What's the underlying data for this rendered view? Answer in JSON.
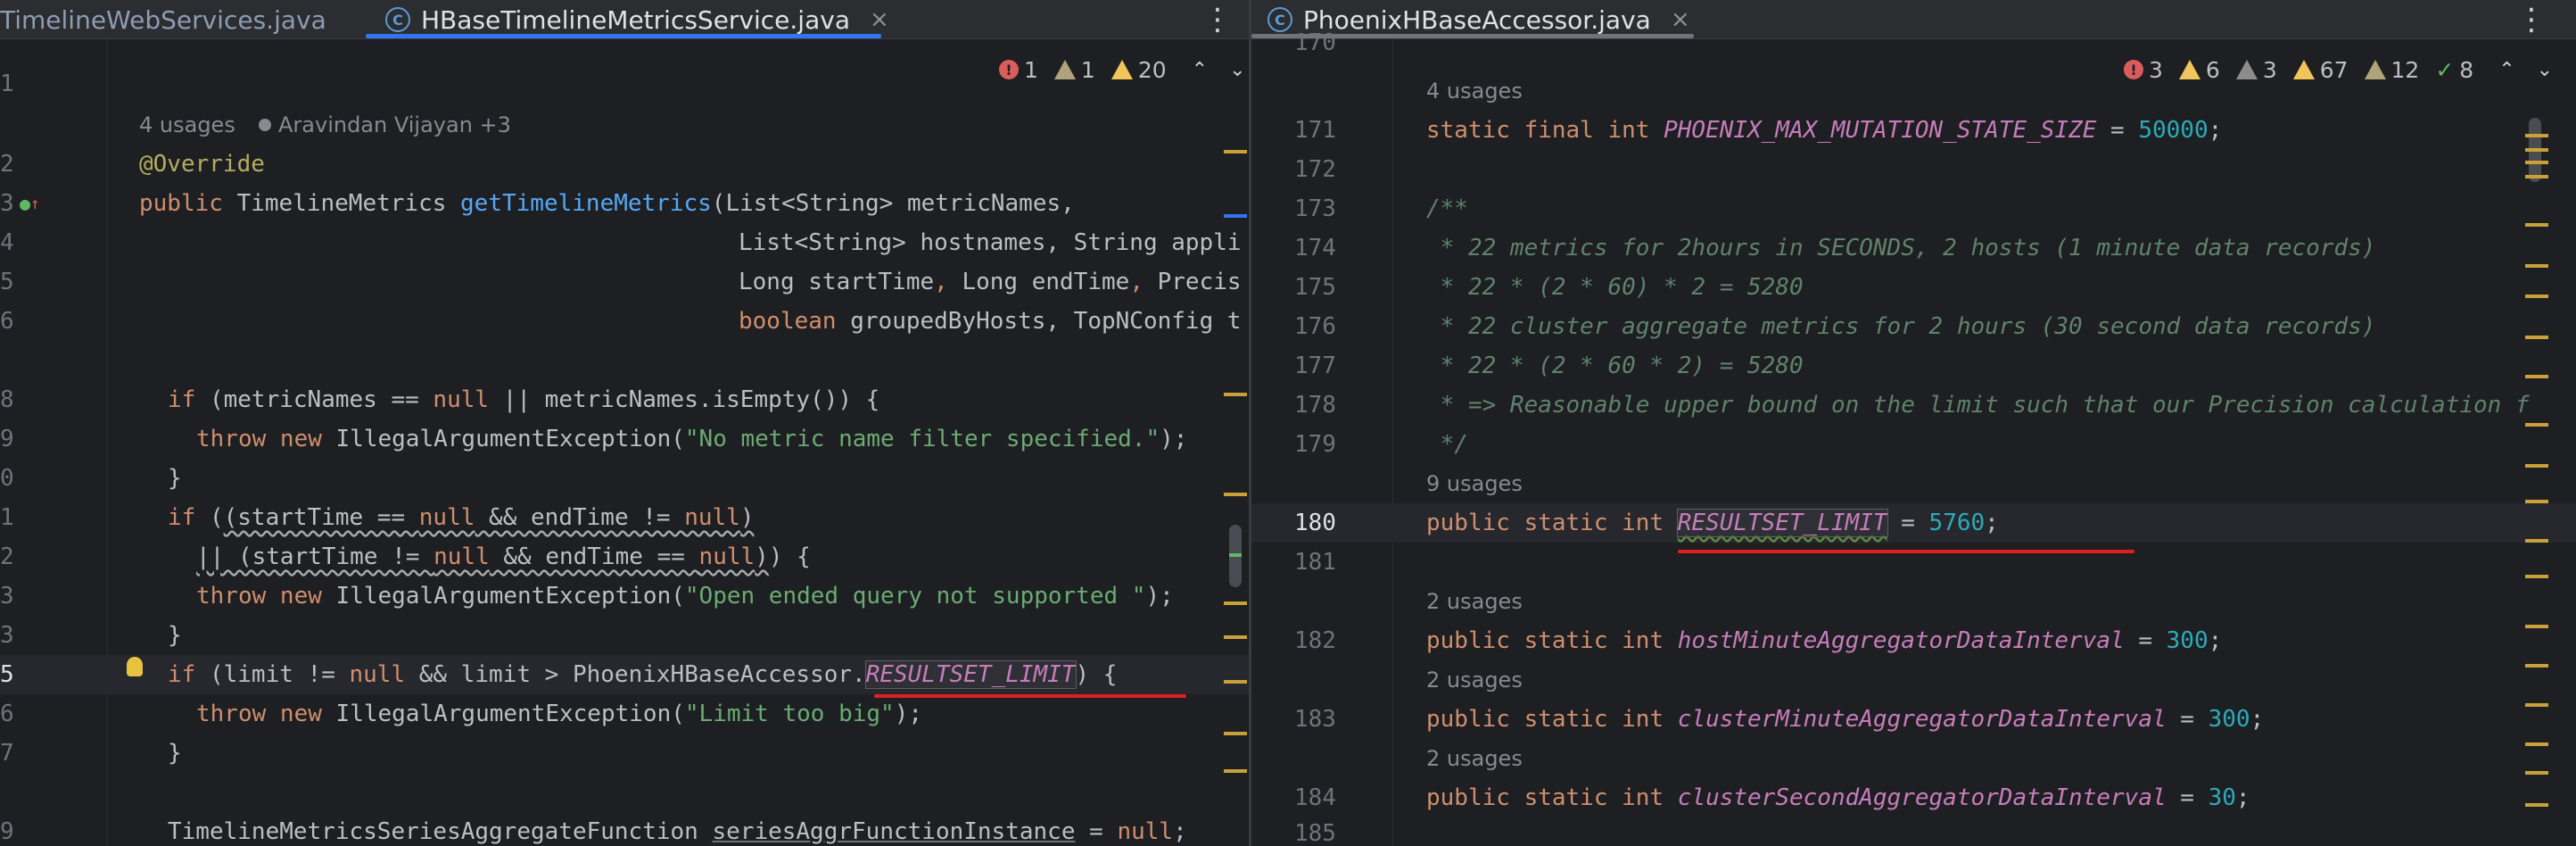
{
  "left": {
    "tabs": [
      {
        "label": "TimelineWebServices.java",
        "active": false
      },
      {
        "label": "HBaseTimelineMetricsService.java",
        "active": true
      }
    ],
    "inspections": {
      "errors": "1",
      "weak_warnings": "1",
      "warnings": "20"
    },
    "hints": {
      "usages": "4 usages",
      "author": "Aravindan Vijayan +3"
    },
    "line_numbers": [
      "",
      "1",
      "",
      "2",
      "3",
      "4",
      "5",
      "6",
      "7",
      "8",
      "9",
      "0",
      "1",
      "2",
      "3",
      "3",
      "5",
      "6",
      "7",
      "8",
      "9"
    ],
    "code": {
      "l0": "}",
      "l2": "@Override",
      "l3_kw": "public",
      "l3_type": " TimelineMetrics ",
      "l3_fn": "getTimelineMetrics",
      "l3_rest": "(List<String> metricNames,",
      "l4": "List<String> hostnames, String appli",
      "l5a": "Long startTime",
      "l5b": ", ",
      "l5c": "Long endTime",
      "l5d": ", Precis",
      "l6_kw": "boolean",
      "l6_rest": " groupedByHosts, TopNConfig t",
      "l8_kw": "if",
      "l8_a": " (metricNames == ",
      "l8_null": "null",
      "l8_b": " || metricNames.isEmpty()) {",
      "l9_kw": "throw new",
      "l9_a": " IllegalArgumentException(",
      "l9_str": "\"No metric name filter specified.\"",
      "l9_b": ");",
      "l10": "}",
      "l11_kw": "if",
      "l11_a": " ((startTime == ",
      "l11_null1": "null",
      "l11_b": " && endTime != ",
      "l11_null2": "null",
      "l11_c": ")",
      "l12_a": "|| (startTime != ",
      "l12_null1": "null",
      "l12_b": " && endTime == ",
      "l12_null2": "null",
      "l12_c": ")) {",
      "l13_kw": "throw new",
      "l13_a": " IllegalArgumentException(",
      "l13_str": "\"Open ended query not supported \"",
      "l13_b": ");",
      "l14": "}",
      "l15_kw": "if",
      "l15_a": " (limit != ",
      "l15_null": "null",
      "l15_b": " && limit > PhoenixHBaseAccessor.",
      "l15_fld": "RESULTSET_LIMIT",
      "l15_c": ") {",
      "l16_kw": "throw new",
      "l16_a": " IllegalArgumentException(",
      "l16_str": "\"Limit too big\"",
      "l16_b": ");",
      "l17": "}",
      "l19_a": "TimelineMetricsSeriesAggregateFunction ",
      "l19_var": "seriesAggrFunctionInstance",
      "l19_b": " = ",
      "l19_null": "null",
      "l19_c": ";"
    }
  },
  "right": {
    "tabs": [
      {
        "label": "PhoenixHBaseAccessor.java",
        "active": true
      }
    ],
    "inspections": {
      "errors": "3",
      "warnings": "6",
      "weak_warnings": "3",
      "warnings2": "67",
      "typos": "12",
      "ok": "8"
    },
    "line_numbers": [
      "170",
      "171",
      "172",
      "173",
      "174",
      "175",
      "176",
      "177",
      "178",
      "179",
      "180",
      "181",
      "182",
      "183",
      "184",
      "185"
    ],
    "hints": {
      "u171": "4 usages",
      "u180": "9 usages",
      "u182": "2 usages",
      "u183": "2 usages",
      "u184": "2 usages"
    },
    "code": {
      "l171_kw": "static final int ",
      "l171_fld": "PHOENIX_MAX_MUTATION_STATE_SIZE",
      "l171_a": " = ",
      "l171_num": "50000",
      "l171_b": ";",
      "l173": "/**",
      "l174": " * 22 metrics for 2hours in SECONDS, 2 hosts (1 minute data records)",
      "l175": " * 22 * (2 * 60) * 2 = 5280",
      "l176": " * 22 cluster aggregate metrics for 2 hours (30 second data records)",
      "l177": " * 22 * (2 * 60 * 2) = 5280",
      "l178": " * => Reasonable upper bound on the limit such that our Precision calculation f",
      "l179": " */",
      "l180_kw": "public static int ",
      "l180_fld": "RESULTSET_LIMIT",
      "l180_a": " = ",
      "l180_num": "5760",
      "l180_b": ";",
      "l182_kw": "public static int ",
      "l182_fld": "hostMinuteAggregatorDataInterval",
      "l182_a": " = ",
      "l182_num": "300",
      "l182_b": ";",
      "l183_kw": "public static int ",
      "l183_fld": "clusterMinuteAggregatorDataInterval",
      "l183_a": " = ",
      "l183_num": "300",
      "l183_b": ";",
      "l184_kw": "public static int ",
      "l184_fld": "clusterSecondAggregatorDataInterval",
      "l184_a": " = ",
      "l184_num": "30",
      "l184_b": ";"
    }
  },
  "icons": {
    "close": "×",
    "kebab": "⋮",
    "chevron_up": "⌃",
    "chevron_down": "⌄",
    "class_icon": "C",
    "check": "✓"
  }
}
